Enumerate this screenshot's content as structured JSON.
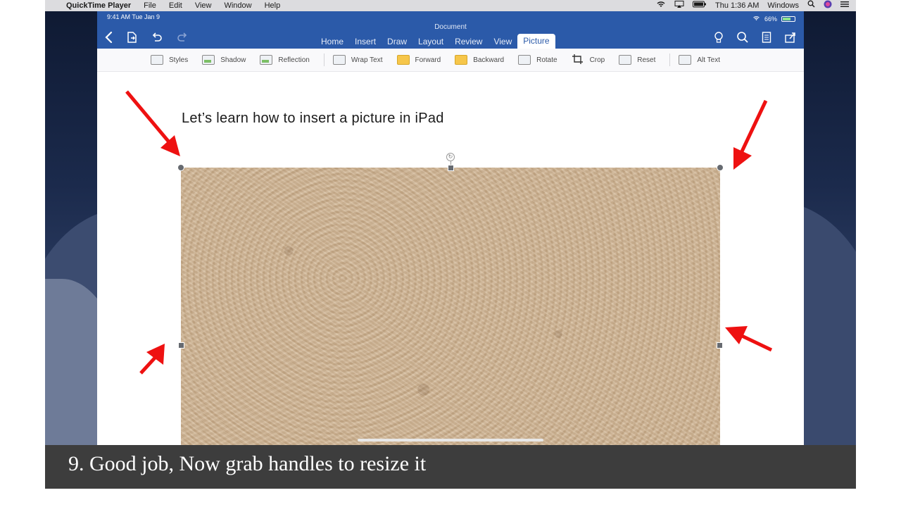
{
  "menubar": {
    "app_name": "QuickTime Player",
    "items": [
      "File",
      "Edit",
      "View",
      "Window",
      "Help"
    ],
    "clock": "Thu 1:36 AM",
    "user": "Windows"
  },
  "ipad": {
    "status_time": "9:41 AM   Tue Jan 9",
    "battery": "66%",
    "document_title": "Document",
    "tabs": [
      "Home",
      "Insert",
      "Draw",
      "Layout",
      "Review",
      "View",
      "Picture"
    ],
    "active_tab": "Picture",
    "ribbon": {
      "styles": "Styles",
      "shadow": "Shadow",
      "reflection": "Reflection",
      "wrap_text": "Wrap Text",
      "forward": "Forward",
      "backward": "Backward",
      "rotate": "Rotate",
      "crop": "Crop",
      "reset": "Reset",
      "alt_text": "Alt Text"
    },
    "document": {
      "heading": "Let’s learn how to insert a picture in iPad"
    }
  },
  "caption": "9. Good job, Now grab handles to resize it",
  "colors": {
    "header_blue": "#2b5aa9",
    "arrow_red": "#ee1111",
    "caption_bg": "#3d3d3d"
  },
  "icons": [
    "apple-icon",
    "wifi-icon",
    "airplay-icon",
    "battery-icon",
    "search-icon",
    "siri-icon",
    "menu-icon",
    "back-icon",
    "file-icon",
    "undo-icon",
    "redo-icon",
    "lightbulb-icon",
    "search-icon",
    "reader-icon",
    "share-icon"
  ]
}
